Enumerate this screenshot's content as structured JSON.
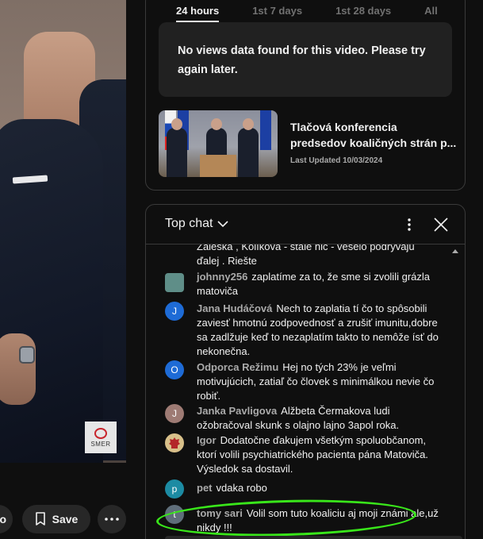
{
  "video": {
    "watermark": "SMER"
  },
  "actions": {
    "save_label": "Save",
    "partial_label": "o"
  },
  "analytics": {
    "tabs": [
      {
        "label": "24 hours",
        "active": true
      },
      {
        "label": "1st 7 days",
        "active": false
      },
      {
        "label": "1st 28 days",
        "active": false
      },
      {
        "label": "All",
        "active": false
      }
    ],
    "no_data_line1": "No views data found for this video. Please try",
    "no_data_line2": "again later.",
    "video_title_line1": "Tlačová konferencia",
    "video_title_line2": "predsedov koaličných strán p...",
    "last_updated": "Last Updated 10/03/2024"
  },
  "chat": {
    "title": "Top chat",
    "messages": [
      {
        "author": "",
        "text_line1": "Žaleská , Kolíková - stále nič - veselo podrývajú",
        "text_line2": "ďalej . Riešte",
        "avatar": ""
      },
      {
        "author": "johnny256",
        "text": "zaplatíme za to, že sme si zvolili grázla matoviča",
        "avatar": "img",
        "avatar_color": "#5f8e88"
      },
      {
        "author": "Jana Hudáčová",
        "text": "Nech to zaplatia tí čo to spôsobili zaviesť hmotnú zodpovednosť a zrušiť imunitu,dobre sa zadlžuje keď to nezaplatím takto to nemôže ísť do nekonečna.",
        "avatar": "J",
        "avatar_color": "#1e6bd6"
      },
      {
        "author": "Odporca Režimu",
        "text": "Hej no tých 23% je veľmi motivujúcich, zatiaľ čo človek s minimálkou nevie čo robiť.",
        "avatar": "O",
        "avatar_color": "#1e6bd6"
      },
      {
        "author": "Janka Pavligova",
        "text": "Alžbeta Čermakova ludi ožobračoval skunk s olajno lajno 3apol roka.",
        "avatar": "J",
        "avatar_color": "#9e7b74"
      },
      {
        "author": "Igor",
        "text": "Dodatočne ďakujem všetkým spoluobčanom, ktorí volili psychiatrického pacienta pána Matoviča. Výsledok sa dostavil.",
        "avatar": "crest",
        "avatar_color": "#d8c08a"
      },
      {
        "author": "pet",
        "text": "vdaka robo",
        "avatar": "p",
        "avatar_color": "#1c8ba3"
      },
      {
        "author": "tomy sari",
        "text": "Volil som tuto koaliciu aj moji známi ale,už nikdy !!!",
        "avatar": "t",
        "avatar_color": "#5f6e7a"
      }
    ]
  },
  "colors": {
    "highlight": "#39e61a",
    "chat_bg": "#0f0f0f",
    "muted": "#aaaaaa"
  }
}
